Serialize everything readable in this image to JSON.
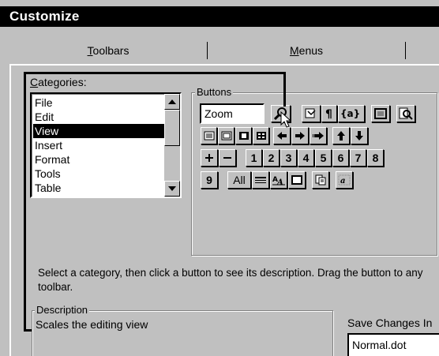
{
  "window": {
    "title": "Customize"
  },
  "tabs": [
    {
      "label": "Toolbars",
      "mnemonic": "T",
      "rest": "oolbars"
    },
    {
      "label": "Menus",
      "mnemonic": "M",
      "rest": "enus"
    }
  ],
  "categories": {
    "label": "Categories:",
    "mnemonic": "C",
    "rest": "ategories:",
    "items": [
      "File",
      "Edit",
      "View",
      "Insert",
      "Format",
      "Tools",
      "Table"
    ],
    "selected": "View"
  },
  "buttons_group": {
    "label": "Buttons",
    "zoom_value": "Zoom",
    "row3_numbers": [
      "1",
      "2",
      "3",
      "4",
      "5",
      "6",
      "7",
      "8"
    ],
    "row4_number": "9",
    "all_label": "All"
  },
  "instructions": "Select a category, then click a button to see its description. Drag the button to any toolbar.",
  "description": {
    "label": "Description",
    "text": "Scales the editing view"
  },
  "save_changes": {
    "label": "Save Changes In",
    "value": "Normal.dot"
  }
}
